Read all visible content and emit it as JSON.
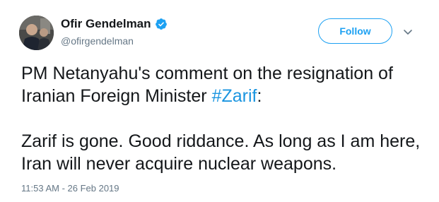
{
  "user": {
    "display_name": "Ofir Gendelman",
    "handle": "@ofirgendelman",
    "verified": true
  },
  "follow_button": {
    "label": "Follow"
  },
  "menu": {
    "icon": "chevron-down-icon"
  },
  "tweet": {
    "line1_text": "PM Netanyahu's comment on the resignation of Iranian Foreign Minister ",
    "hashtag": "#Zarif",
    "line1_suffix": ":",
    "paragraph2": "Zarif is gone. Good riddance. As long as I am here, Iran will never acquire nuclear weapons."
  },
  "timestamp": "11:53 AM - 26 Feb 2019",
  "colors": {
    "accent": "#1da1f2",
    "hashtag": "#1b95e0",
    "secondary_text": "#657786",
    "primary_text": "#14171a"
  }
}
